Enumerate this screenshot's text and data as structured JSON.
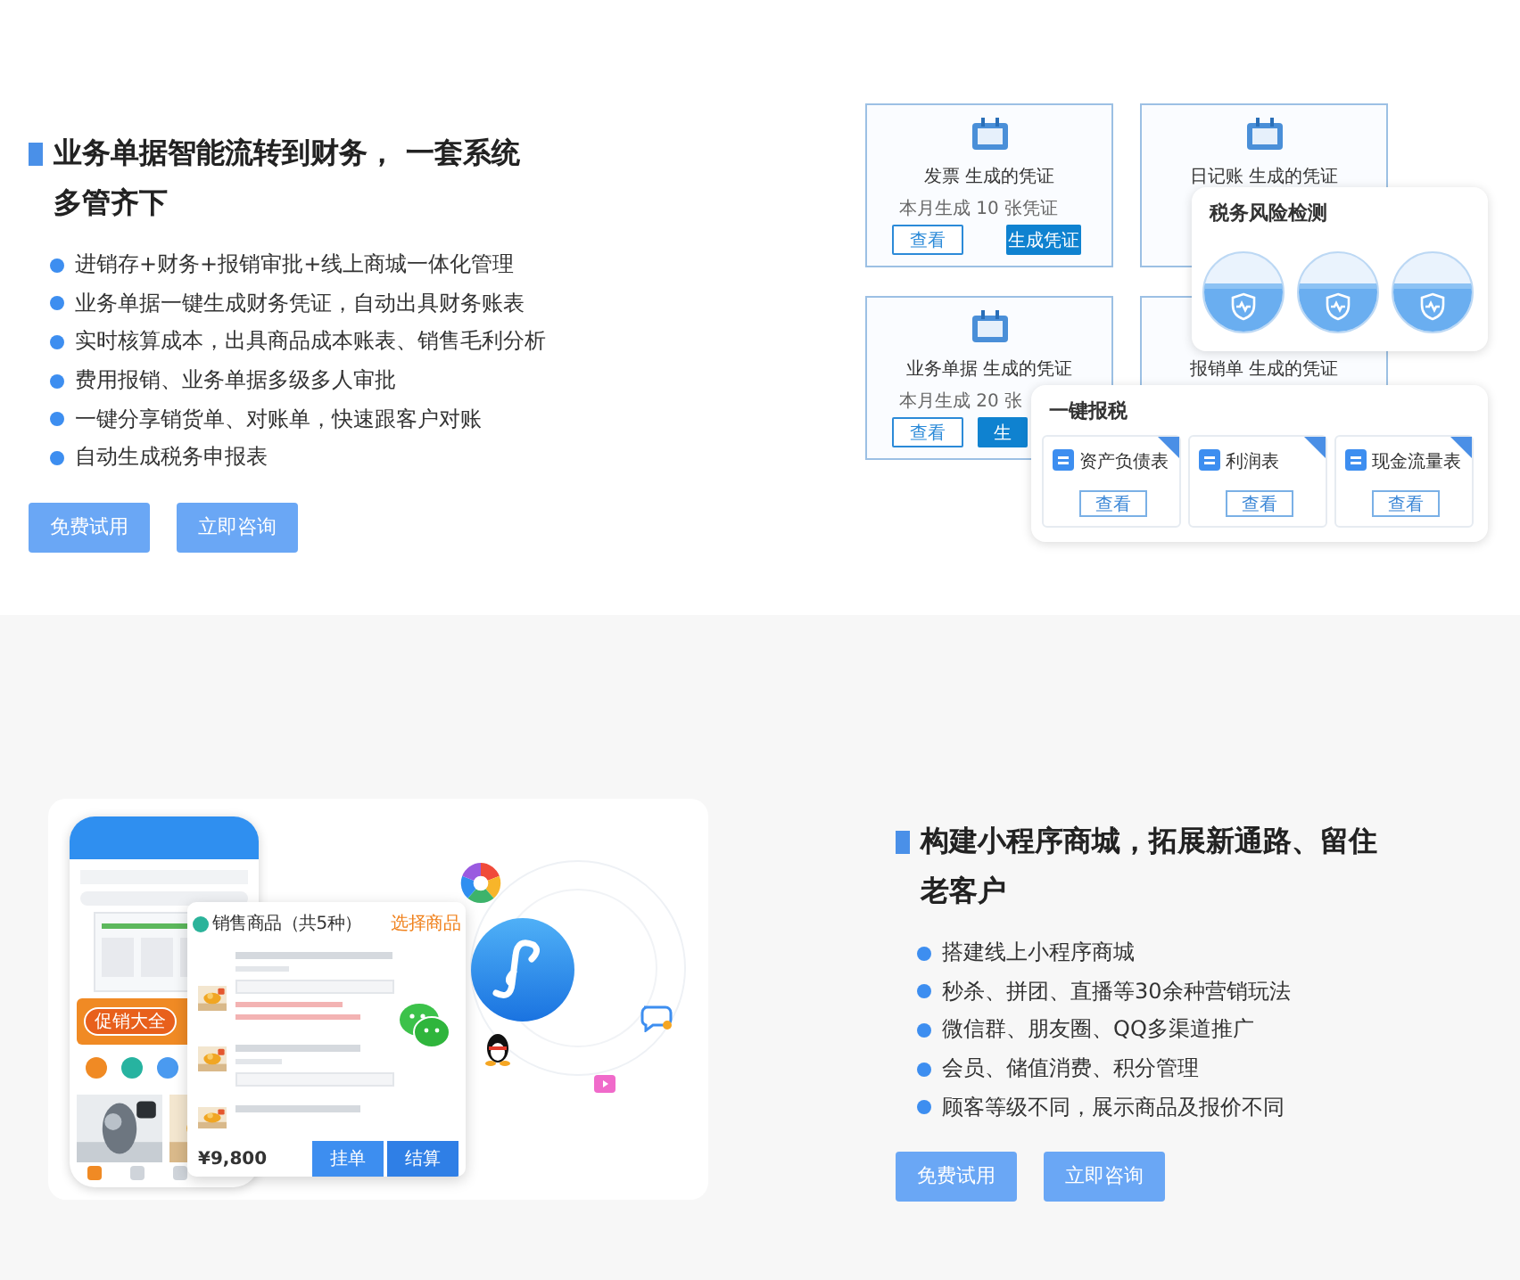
{
  "sections": [
    {
      "heading": "业务单据智能流转到财务， 一套系统多管齐下",
      "bullets": [
        "进销存+财务+报销审批+线上商城一体化管理",
        "业务单据一键生成财务凭证，自动出具财务账表",
        "实时核算成本，出具商品成本账表、销售毛利分析",
        "费用报销、业务单据多级多人审批",
        "一键分享销货单、对账单，快速跟客户对账",
        "自动生成税务申报表"
      ],
      "buttons": [
        "免费试用",
        "立即咨询"
      ],
      "illustration": {
        "kind": "finance",
        "vouchers": [
          {
            "title": "发票 生成的凭证",
            "note": "本月生成 10 张凭证",
            "buttons": [
              "查看",
              "生成凭证"
            ]
          },
          {
            "title": "日记账 生成的凭证"
          },
          {
            "title": "业务单据 生成的凭证",
            "note": "本月生成 20 张",
            "buttons": [
              "查看",
              "生"
            ]
          },
          {
            "title": "报销单 生成的凭证"
          }
        ],
        "risk": {
          "title": "税务风险检测",
          "gauges": [
            {
              "kind": "shield"
            },
            {
              "kind": "shield"
            },
            {
              "kind": "shield"
            }
          ]
        },
        "tax": {
          "title": "一键报税",
          "items": [
            {
              "name": "资产负债表",
              "button": "查看"
            },
            {
              "name": "利润表",
              "button": "查看"
            },
            {
              "name": "现金流量表",
              "button": "查看"
            }
          ]
        }
      }
    },
    {
      "heading": "构建小程序商城，拓展新通路、留住老客户",
      "bullets": [
        "搭建线上小程序商城",
        "秒杀、拼团、直播等30余种营销玩法",
        "微信群、朋友圈、QQ多渠道推广",
        "会员、储值消费、积分管理",
        "顾客等级不同，展示商品及报价不同"
      ],
      "buttons": [
        "免费试用",
        "立即咨询"
      ],
      "illustration": {
        "kind": "mall",
        "promo": "促销大全",
        "popup": {
          "title": "销售商品（共5种）",
          "action": "选择商品",
          "total": "¥9,800",
          "buttons": [
            "挂单",
            "结算"
          ]
        }
      }
    }
  ]
}
